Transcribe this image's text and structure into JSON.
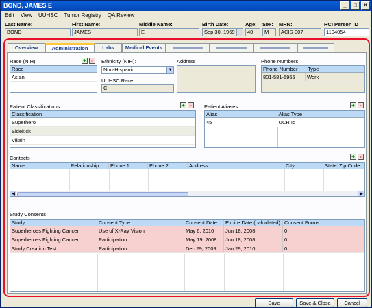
{
  "window": {
    "title": "BOND, JAMES E",
    "controls": [
      "_",
      "□",
      "×"
    ]
  },
  "menu": [
    {
      "label": "Edit"
    },
    {
      "label": "View"
    },
    {
      "label": "UUHSC"
    },
    {
      "label": "Tumor Registry"
    },
    {
      "label": "QA Review"
    }
  ],
  "header": {
    "last_name_label": "Last Name:",
    "last_name": "BOND",
    "first_name_label": "First Name:",
    "first_name": "JAMES",
    "middle_name_label": "Middle Name:",
    "middle_name": "E",
    "birth_date_label": "Birth Date:",
    "birth_date": "Sep 30, 1969",
    "age_label": "Age:",
    "age": "40",
    "sex_label": "Sex:",
    "sex": "M",
    "mrn_label": "MRN:",
    "mrn": "ACIS-007",
    "hci_label": "HCI Person ID",
    "hci_id": "1104054"
  },
  "tabs": [
    {
      "label": "Overview"
    },
    {
      "label": "Administration"
    },
    {
      "label": "Labs"
    },
    {
      "label": "Medical Events"
    }
  ],
  "race": {
    "label": "Race (NIH)",
    "header": "Race",
    "rows": [
      "Asian"
    ]
  },
  "ethnicity": {
    "label": "Ethnicity (NIH):",
    "value": "Non-Hispanic",
    "uuhsc_label": "UUHSC Race:",
    "uuhsc_value": "C"
  },
  "address": {
    "label": "Address"
  },
  "phone": {
    "label": "Phone Numbers",
    "headers": [
      "Phone Number",
      "Type"
    ],
    "rows": [
      [
        "801-581-5965",
        "Work"
      ]
    ]
  },
  "classifications": {
    "label": "Patient Classifications",
    "header": "Classification",
    "rows": [
      "Superhero",
      "Sidekick",
      "Villain"
    ]
  },
  "aliases": {
    "label": "Patient Aliases",
    "headers": [
      "Alias",
      "Alias Type"
    ],
    "rows": [
      [
        "45",
        "UCR Id"
      ]
    ]
  },
  "contacts": {
    "label": "Contacts",
    "headers": [
      "Name",
      "Relationship",
      "Phone 1",
      "Phone 2",
      "Address",
      "City",
      "State",
      "Zip Code"
    ]
  },
  "consents": {
    "label": "Study Consents",
    "headers": [
      "Study",
      "Consent Type",
      "Consent Date",
      "Expire Date (calculated)",
      "Consent Forms"
    ],
    "rows": [
      [
        "Superheroes Fighting Cancer",
        "Use of X-Ray Vision",
        "May 6, 2010",
        "Jun 18, 2008",
        "0"
      ],
      [
        "Superheroes Fighting Cancer",
        "Participation",
        "May 19, 2008",
        "Jun 18, 2008",
        "0"
      ],
      [
        "Study Creation Test",
        "Participation",
        "Dec 29, 2009",
        "Jan 29, 2010",
        "0"
      ]
    ]
  },
  "buttons": {
    "save": "Save",
    "save_close": "Save & Close",
    "cancel": "Cancel"
  },
  "colors": {
    "highlight_frame": "#e8102a",
    "consent_row": "#f7d0d0",
    "header_bg": "#bcd9f5"
  }
}
